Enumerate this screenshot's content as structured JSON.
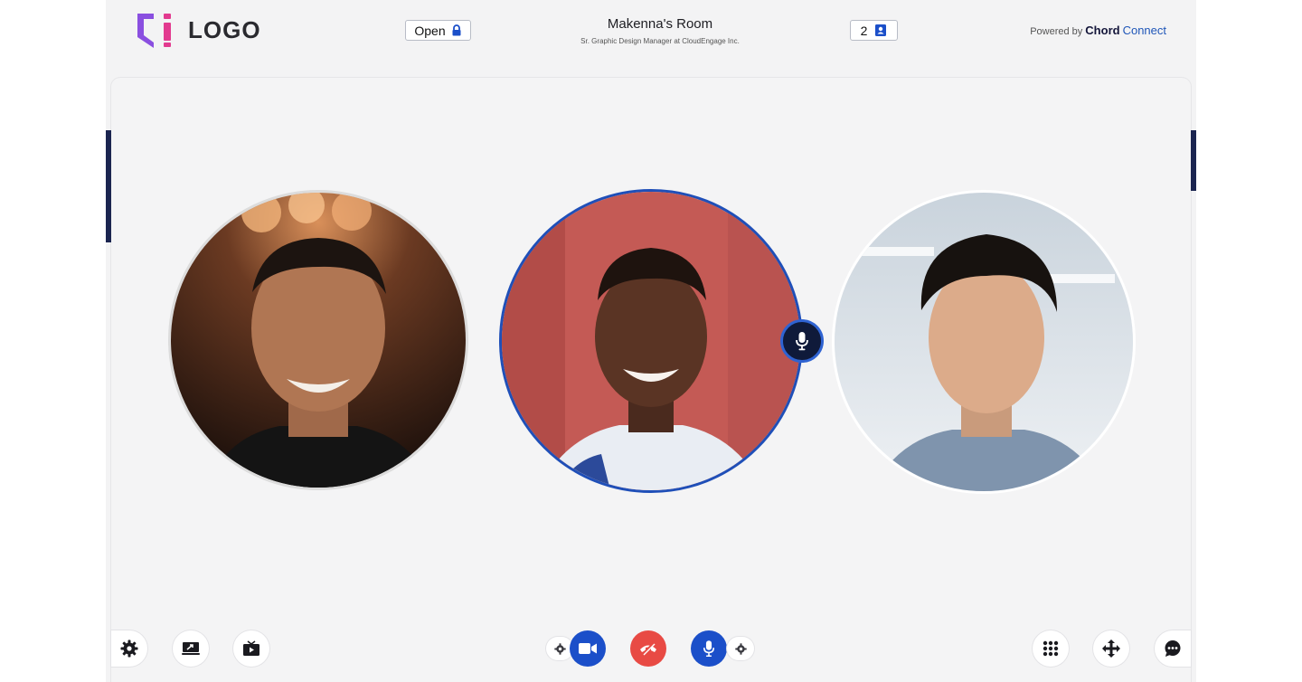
{
  "header": {
    "logo_text": "LOGO",
    "lock_label": "Open",
    "room_title": "Makenna's Room",
    "room_subtitle": "Sr. Graphic Design Manager at CloudEngage Inc.",
    "participant_count": "2",
    "powered_prefix": "Powered by",
    "brand_part1": "Chord",
    "brand_part2": "Connect"
  },
  "participants": [
    {
      "id": "participant-1",
      "icon": "person-avatar"
    },
    {
      "id": "participant-2",
      "icon": "person-avatar",
      "speaking": true
    },
    {
      "id": "participant-3",
      "icon": "person-avatar"
    }
  ],
  "controls": {
    "left": [
      "gear-icon",
      "screen-share-icon",
      "media-player-icon"
    ],
    "center": [
      "gear-icon",
      "video-camera-icon",
      "hang-up-icon",
      "microphone-icon",
      "gear-icon"
    ],
    "right": [
      "dialpad-icon",
      "move-arrows-icon",
      "chat-bubble-icon"
    ]
  },
  "colors": {
    "accent_blue": "#1b4fc9",
    "hangup_red": "#e84a44",
    "logo_purple": "#8a4fe0",
    "logo_pink": "#e23a8f",
    "navy": "#1b2550"
  }
}
